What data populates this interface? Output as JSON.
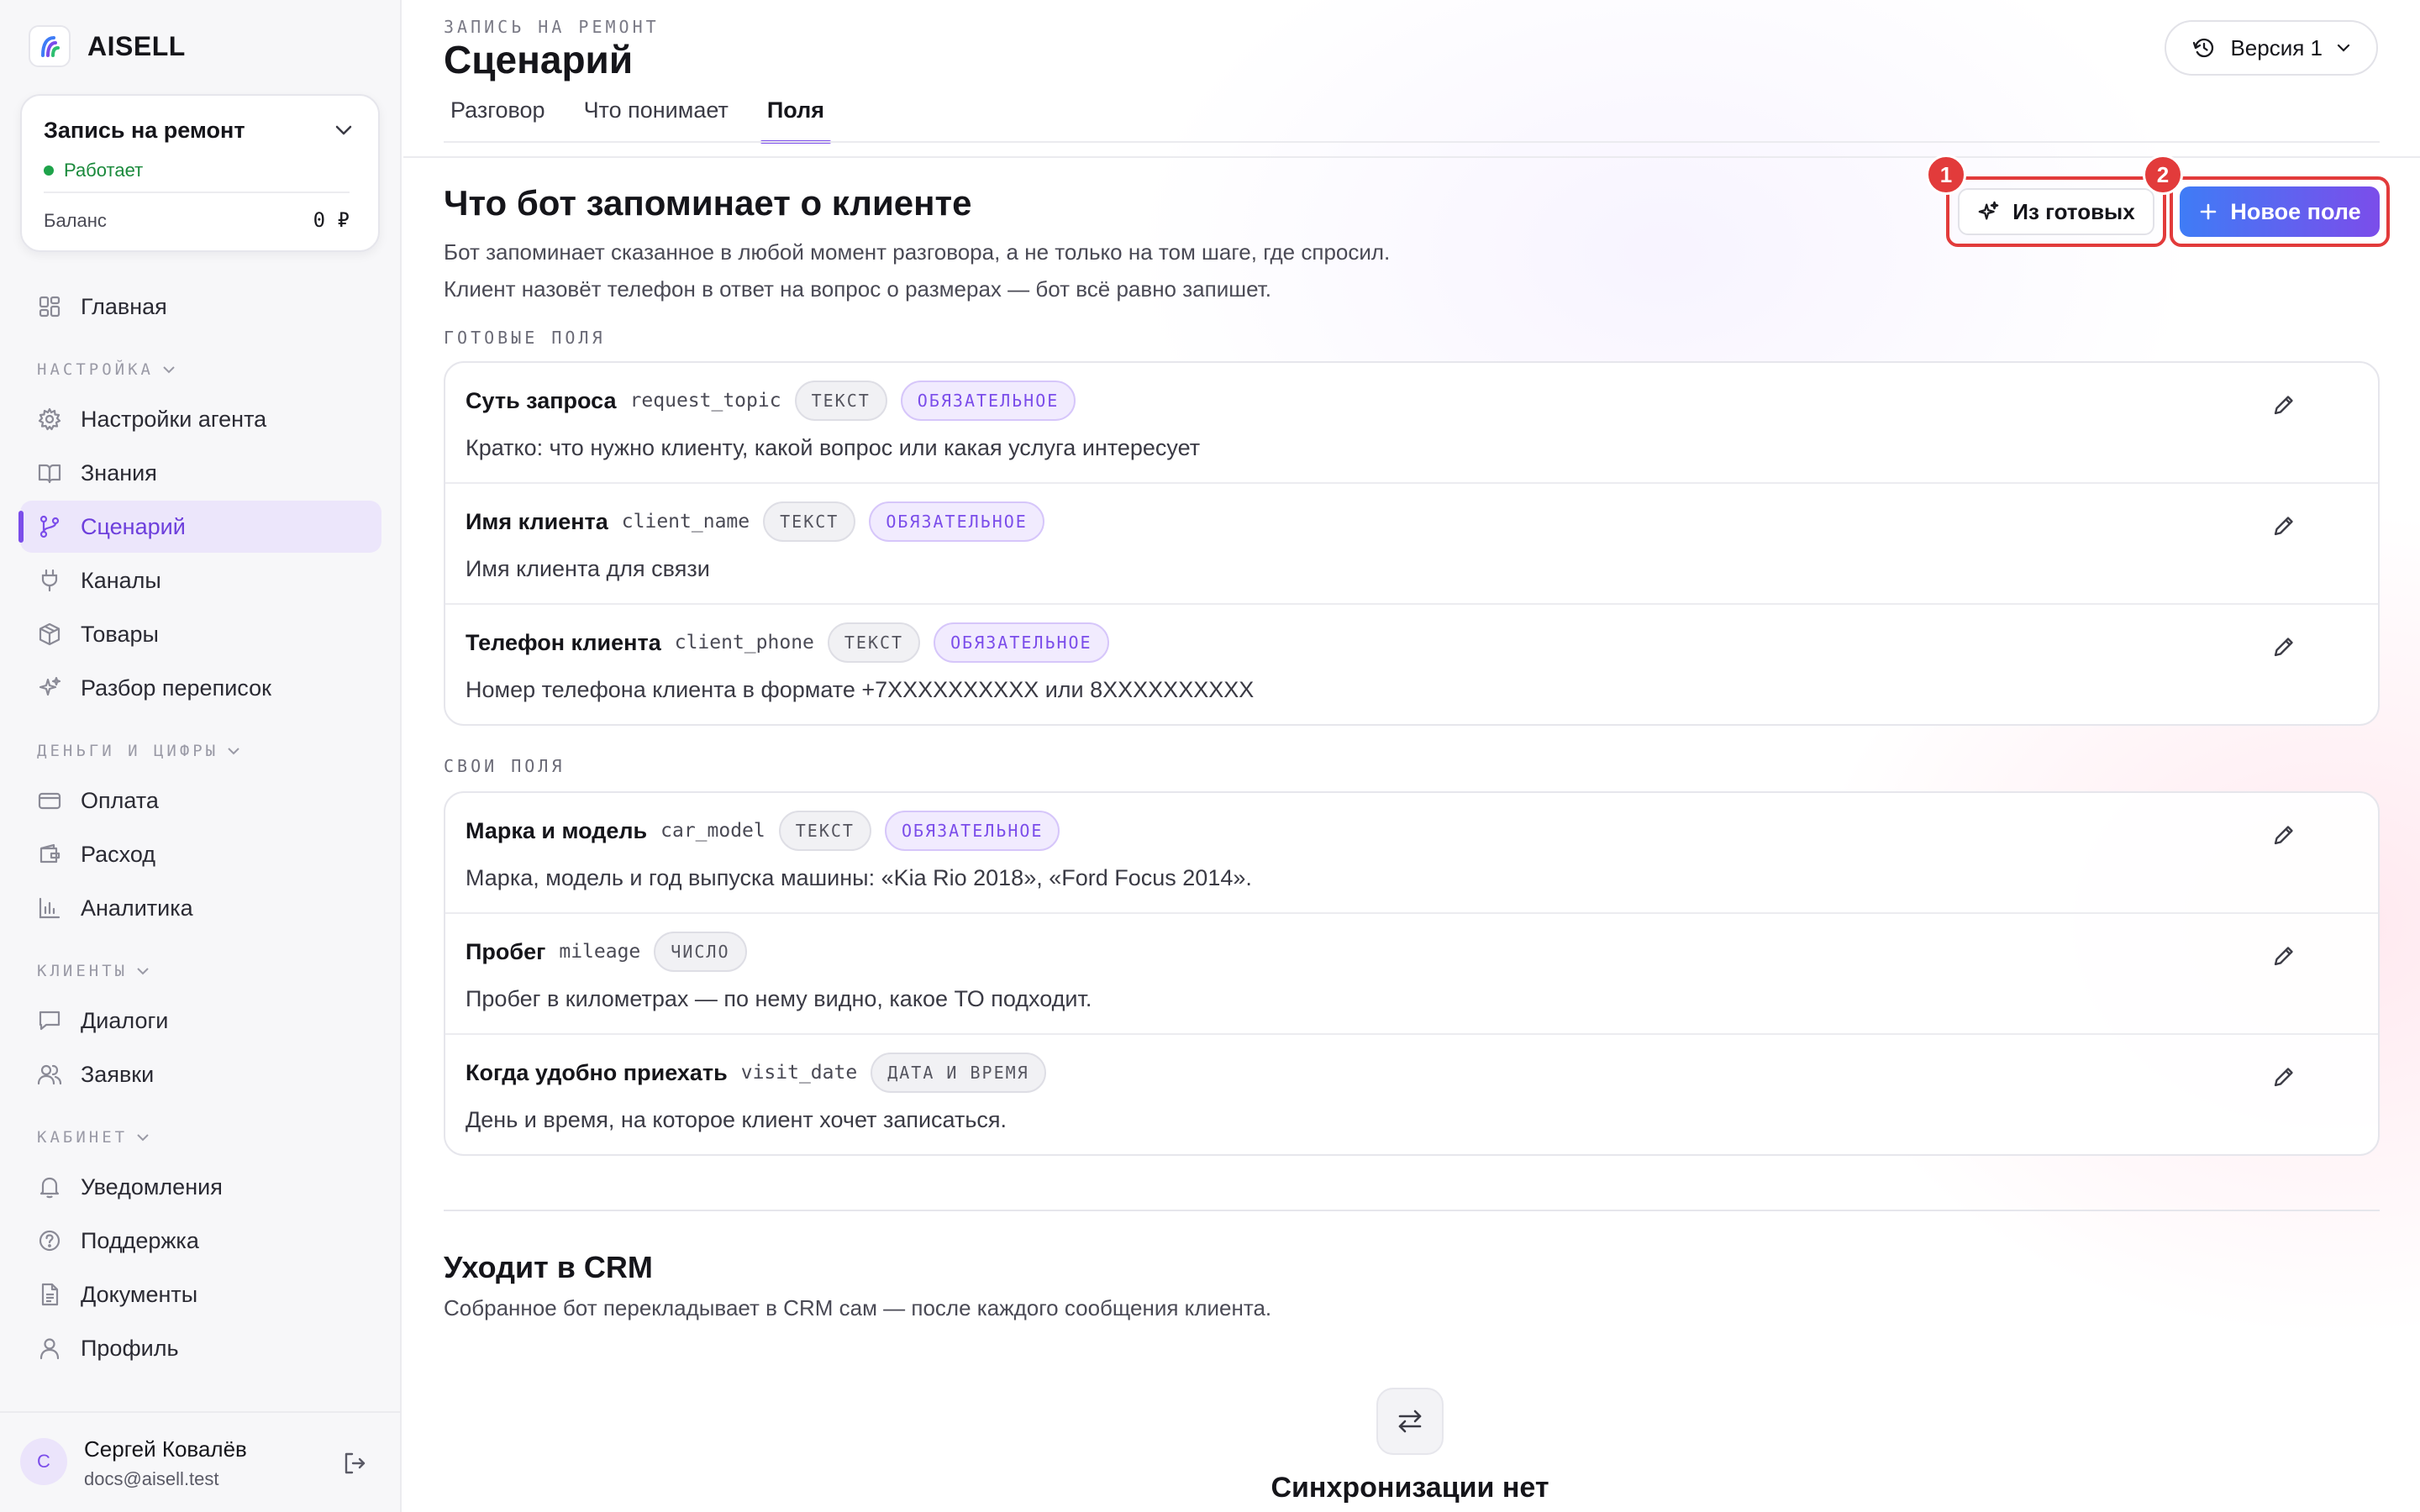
{
  "brand": {
    "name": "AISELL"
  },
  "project": {
    "title": "Запись на ремонт",
    "status": "Работает",
    "balance_label": "Баланс",
    "balance_value": "0 ₽"
  },
  "nav": {
    "home": "Главная",
    "section_setup": "НАСТРОЙКА",
    "agent_settings": "Настройки агента",
    "knowledge": "Знания",
    "scenario": "Сценарий",
    "channels": "Каналы",
    "products": "Товары",
    "review": "Разбор переписок",
    "section_money": "ДЕНЬГИ И ЦИФРЫ",
    "payment": "Оплата",
    "expense": "Расход",
    "analytics": "Аналитика",
    "section_clients": "КЛИЕНТЫ",
    "dialogs": "Диалоги",
    "requests": "Заявки",
    "section_cabinet": "КАБИНЕТ",
    "notifications": "Уведомления",
    "support": "Поддержка",
    "documents": "Документы",
    "profile": "Профиль"
  },
  "user": {
    "initial": "С",
    "name": "Сергей Ковалёв",
    "email": "docs@aisell.test"
  },
  "header": {
    "eyebrow": "ЗАПИСЬ НА РЕМОНТ",
    "title": "Сценарий",
    "tabs": [
      "Разговор",
      "Что понимает",
      "Поля"
    ],
    "active_tab": "Поля",
    "version_label": "Версия 1"
  },
  "fields_section": {
    "title": "Что бот запоминает о клиенте",
    "desc_line1": "Бот запоминает сказанное в любой момент разговора, а не только на том шаге, где спросил.",
    "desc_line2": "Клиент назовёт телефон в ответ на вопрос о размерах — бот всё равно запишет.",
    "from_ready_label": "Из готовых",
    "new_field_label": "Новое поле",
    "marker_1": "1",
    "marker_2": "2"
  },
  "ready_fields": {
    "label": "ГОТОВЫЕ ПОЛЯ",
    "rows": [
      {
        "name": "Суть запроса",
        "key": "request_topic",
        "type": "ТЕКСТ",
        "required": "ОБЯЗАТЕЛЬНОЕ",
        "desc": "Кратко: что нужно клиенту, какой вопрос или какая услуга интересует"
      },
      {
        "name": "Имя клиента",
        "key": "client_name",
        "type": "ТЕКСТ",
        "required": "ОБЯЗАТЕЛЬНОЕ",
        "desc": "Имя клиента для связи"
      },
      {
        "name": "Телефон клиента",
        "key": "client_phone",
        "type": "ТЕКСТ",
        "required": "ОБЯЗАТЕЛЬНОЕ",
        "desc": "Номер телефона клиента в формате +7XXXXXXXXXX или 8XXXXXXXXXX"
      }
    ]
  },
  "custom_fields": {
    "label": "СВОИ ПОЛЯ",
    "rows": [
      {
        "name": "Марка и модель",
        "key": "car_model",
        "type": "ТЕКСТ",
        "required": "ОБЯЗАТЕЛЬНОЕ",
        "desc": "Марка, модель и год выпуска машины: «Kia Rio 2018», «Ford Focus 2014»."
      },
      {
        "name": "Пробег",
        "key": "mileage",
        "type": "ЧИСЛО",
        "desc": "Пробег в километрах — по нему видно, какое ТО подходит."
      },
      {
        "name": "Когда удобно приехать",
        "key": "visit_date",
        "type": "ДАТА И ВРЕМЯ",
        "desc": "День и время, на которое клиент хочет записаться."
      }
    ]
  },
  "crm": {
    "title": "Уходит в CRM",
    "desc": "Собранное бот перекладывает в CRM сам — после каждого сообщения клиента.",
    "empty_title": "Синхронизации нет"
  },
  "colors": {
    "accent": "#7b4dea",
    "status_green": "#1ea34a",
    "marker_red": "#e23b3b"
  }
}
